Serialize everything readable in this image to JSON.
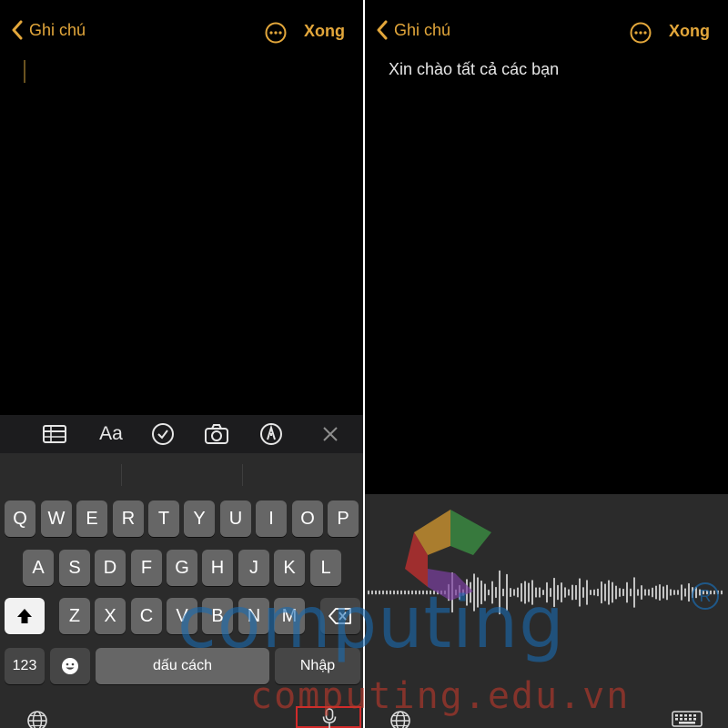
{
  "colors": {
    "accent": "#e3a73b",
    "background": "#000000",
    "keyboard": "#2b2b2b",
    "key": "#666666",
    "highlight_box": "#d12a2a",
    "watermark_blue": "#1a6bb0",
    "watermark_red": "#c0392b"
  },
  "left": {
    "nav": {
      "back_label": "Ghi chú",
      "done_label": "Xong",
      "more_icon": "ellipsis-circle-icon"
    },
    "toolbar": [
      "table-icon",
      "format-text-icon",
      "checklist-icon",
      "camera-icon",
      "markup-icon",
      "close-icon"
    ],
    "toolbar_text": {
      "format": "Aa"
    },
    "keyboard": {
      "row1": [
        "Q",
        "W",
        "E",
        "R",
        "T",
        "Y",
        "U",
        "I",
        "O",
        "P"
      ],
      "row2": [
        "A",
        "S",
        "D",
        "F",
        "G",
        "H",
        "J",
        "K",
        "L"
      ],
      "row3": [
        "Z",
        "X",
        "C",
        "V",
        "B",
        "N",
        "M"
      ],
      "numbers_label": "123",
      "space_label": "dấu cách",
      "return_label": "Nhập"
    }
  },
  "right": {
    "nav": {
      "back_label": "Ghi chú",
      "done_label": "Xong",
      "more_icon": "ellipsis-circle-icon"
    },
    "note_text": "Xin chào tất cả các bạn"
  },
  "watermark": {
    "text": "computing",
    "registered": "R",
    "url": "computing.edu.vn"
  }
}
